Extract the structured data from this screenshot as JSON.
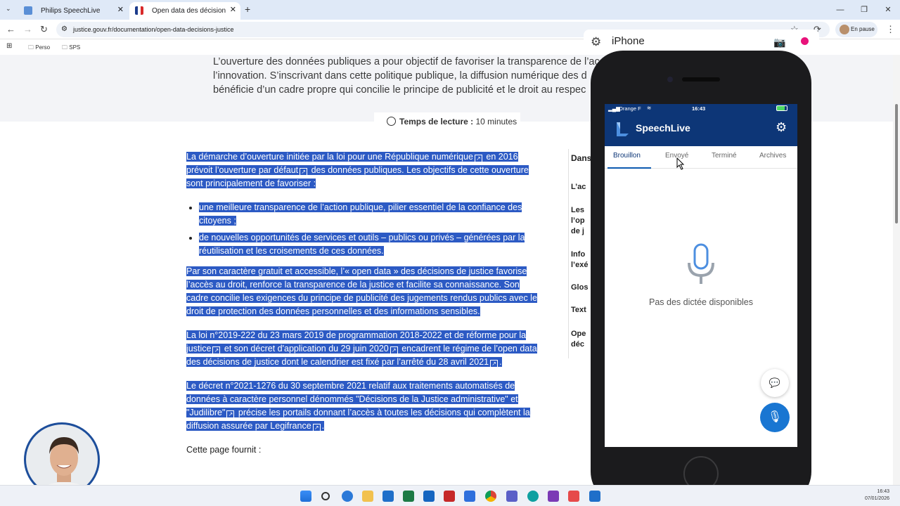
{
  "browser": {
    "tabs": [
      {
        "label": "Philips SpeechLive",
        "active": false
      },
      {
        "label": "Open data des décisions de justi",
        "active": true
      }
    ],
    "url": "justice.gouv.fr/documentation/open-data-decisions-justice",
    "profile_label": "En pause",
    "bookmarks": [
      "Perso",
      "SPS"
    ]
  },
  "page": {
    "intro": [
      "L’ouverture des données publiques a pour objectif de favoriser la transparence de l’ac",
      "l’innovation. S’inscrivant dans cette politique publique, la diffusion numérique des d",
      "bénéficie d’un cadre propre qui concilie le principe de publicité et le droit au respec"
    ],
    "reading_time_label": "Temps de lecture :",
    "reading_time_value": "10 minutes",
    "p1a": "La démarche d’ouverture initiée par la loi pour une République numérique",
    "p1b": " en 2016 prévoit l’ouverture par défaut",
    "p1c": " des données publiques. Les objectifs de cette ouverture sont principalement de favoriser :",
    "bullets": [
      "une meilleure transparence de l’action publique, pilier essentiel de la confiance des citoyens ;",
      "de nouvelles opportunités de services et outils – publics ou privés – générées par la réutilisation et les croisements de ces données."
    ],
    "p2": "Par son caractère gratuit et accessible, l’« open data » des décisions de justice favorise l’accès au droit, renforce la transparence de la justice et facilite sa connaissance. Son cadre concilie les exigences du principe de publicité des jugements rendus publics avec le droit de protection des données personnelles et des informations sensibles.",
    "p3a": "La loi n°2019-222 du 23 mars 2019 de programmation 2018-2022 et de réforme pour la justice",
    "p3b": " et son décret d'application du 29 juin 2020",
    "p3c": " encadrent le régime de l’open data des décisions de justice dont le calendrier est fixé par l’arrêté du 28 avril 2021",
    "p3d": ".",
    "p4a": "Le décret n°2021-1276 du 30 septembre 2021 relatif aux traitements automatisés de données à caractère personnel dénommés \"Décisions de la Justice administrative\" et \"Judilibre\"",
    "p4b": " précise les portails donnant l’accès à toutes les décisions qui complètent la diffusion assurée par Legifrance",
    "p4c": ".",
    "p5": "Cette page fournit :",
    "toc_heading": "Dans",
    "toc_items": [
      "L’ac",
      "Les l’op de j",
      "Info l’exé",
      "Glos",
      "Text",
      "Ope déc"
    ]
  },
  "phone_window": {
    "title": "iPhone"
  },
  "phone": {
    "carrier": "Orange F",
    "time": "16:43",
    "app_name": "SpeechLive",
    "tabs": [
      "Brouillon",
      "Envoyé",
      "Terminé",
      "Archives"
    ],
    "active_tab": "Brouillon",
    "empty_message": "Pas des dictée disponibles",
    "accent": "#0d3677",
    "fab_color": "#1976d2"
  },
  "taskbar": {
    "time": "16:43",
    "date": "07/01/2026"
  }
}
